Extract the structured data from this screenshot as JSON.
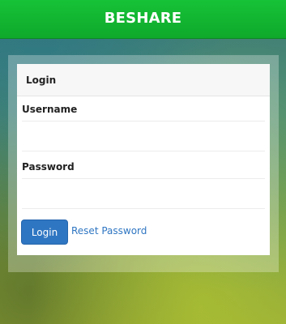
{
  "app": {
    "title": "BESHARE"
  },
  "login_panel": {
    "heading": "Login",
    "username_label": "Username",
    "username_value": "",
    "username_placeholder": "",
    "password_label": "Password",
    "password_value": "",
    "password_placeholder": "",
    "login_button_label": "Login",
    "reset_link_label": "Reset Password"
  },
  "colors": {
    "header_green": "#16c237",
    "button_blue": "#2f76c2",
    "link_blue": "#2f76c2"
  }
}
